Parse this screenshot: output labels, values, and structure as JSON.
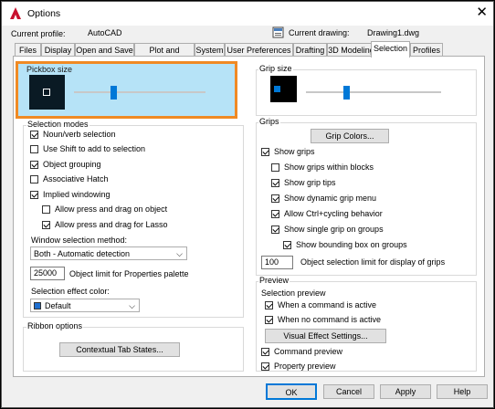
{
  "window": {
    "title": "Options",
    "close_glyph": "✕"
  },
  "profile": {
    "current_profile_label": "Current profile:",
    "current_profile_value": "AutoCAD",
    "current_drawing_label": "Current drawing:",
    "current_drawing_value": "Drawing1.dwg"
  },
  "tabs": [
    "Files",
    "Display",
    "Open and Save",
    "Plot and Publish",
    "System",
    "User Preferences",
    "Drafting",
    "3D Modeling",
    "Selection",
    "Profiles"
  ],
  "active_tab": "Selection",
  "pickbox": {
    "label": "Pickbox size",
    "level": 0.3
  },
  "grip_size": {
    "label": "Grip size",
    "level": 0.3
  },
  "selection_modes": {
    "label": "Selection modes",
    "items": [
      {
        "label": "Noun/verb selection",
        "checked": true
      },
      {
        "label": "Use Shift to add to selection",
        "checked": false
      },
      {
        "label": "Object grouping",
        "checked": true
      },
      {
        "label": "Associative Hatch",
        "checked": false
      },
      {
        "label": "Implied windowing",
        "checked": true
      },
      {
        "label": "Allow press and drag on object",
        "checked": false
      },
      {
        "label": "Allow press and drag for Lasso",
        "checked": true
      }
    ],
    "window_method_label": "Window selection method:",
    "window_method_value": "Both - Automatic detection",
    "object_limit_value": "25000",
    "object_limit_label": "Object limit for Properties palette",
    "effect_color_label": "Selection effect color:",
    "effect_color_value": "Default",
    "effect_color_swatch": "#1e6fd0"
  },
  "ribbon": {
    "label": "Ribbon options",
    "button": "Contextual Tab States..."
  },
  "grips": {
    "label": "Grips",
    "colors_button": "Grip Colors...",
    "items": [
      {
        "label": "Show grips",
        "checked": true
      },
      {
        "label": "Show grips within blocks",
        "checked": false
      },
      {
        "label": "Show grip tips",
        "checked": true
      },
      {
        "label": "Show dynamic grip menu",
        "checked": true
      },
      {
        "label": "Allow Ctrl+cycling behavior",
        "checked": true
      },
      {
        "label": "Show single grip on groups",
        "checked": true
      },
      {
        "label": "Show bounding box on groups",
        "checked": true
      }
    ],
    "limit_value": "100",
    "limit_label": "Object selection limit for display of grips"
  },
  "preview": {
    "label": "Preview",
    "sub_label": "Selection preview",
    "items": [
      {
        "label": "When a command is active",
        "checked": true
      },
      {
        "label": "When no command is active",
        "checked": true
      }
    ],
    "visual_button": "Visual Effect Settings...",
    "extra_items": [
      {
        "label": "Command preview",
        "checked": true
      },
      {
        "label": "Property preview",
        "checked": true
      }
    ]
  },
  "footer": {
    "ok": "OK",
    "cancel": "Cancel",
    "apply": "Apply",
    "help": "Help"
  },
  "colors": {
    "highlight": "#b6e3f7",
    "highlight_border": "#f08a24",
    "accent": "#0078d7",
    "preview_box": "#0a1a24"
  }
}
